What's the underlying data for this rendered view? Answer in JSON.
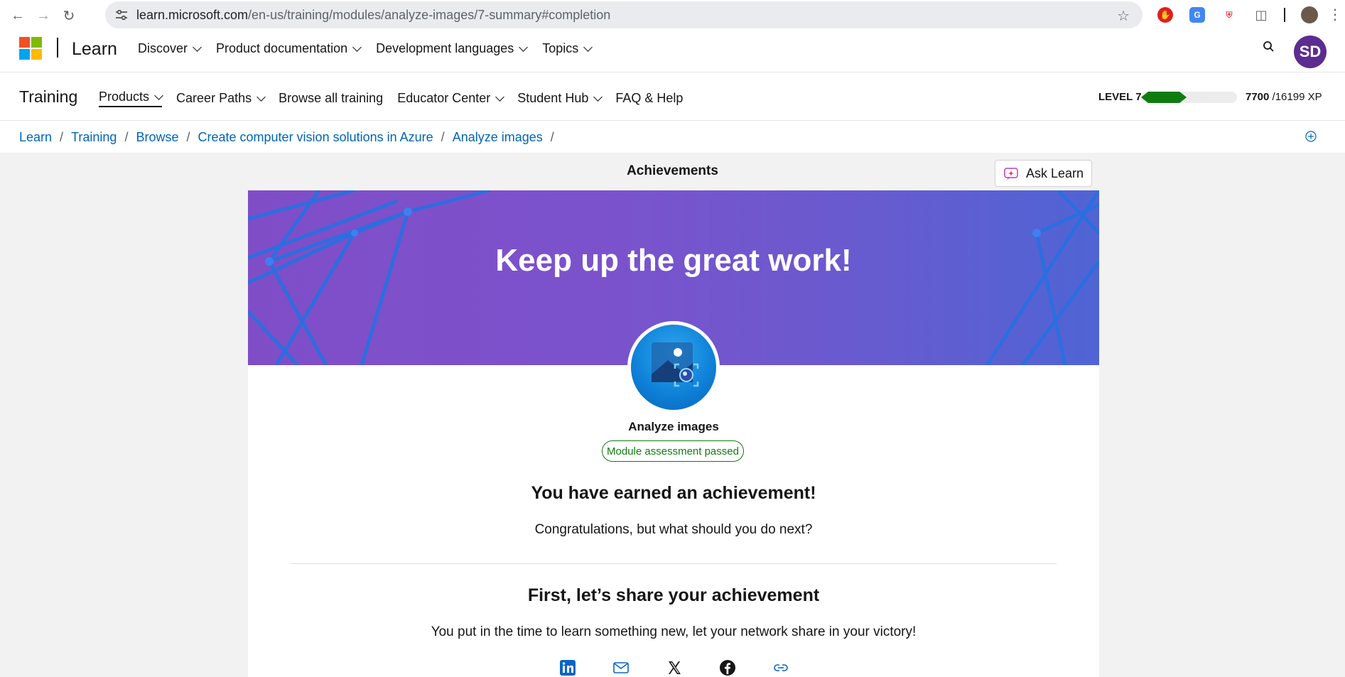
{
  "browser": {
    "url_host": "learn.microsoft.com",
    "url_path": "/en-us/training/modules/analyze-images/7-summary#completion"
  },
  "header": {
    "brand": "Learn",
    "nav": [
      {
        "label": "Discover"
      },
      {
        "label": "Product documentation"
      },
      {
        "label": "Development languages"
      },
      {
        "label": "Topics"
      }
    ],
    "avatar_initials": "SD"
  },
  "training": {
    "title": "Training",
    "nav": [
      {
        "label": "Products",
        "dropdown": true
      },
      {
        "label": "Career Paths",
        "dropdown": true
      },
      {
        "label": "Browse all training",
        "dropdown": false
      },
      {
        "label": "Educator Center",
        "dropdown": true
      },
      {
        "label": "Student Hub",
        "dropdown": true
      },
      {
        "label": "FAQ & Help",
        "dropdown": false
      }
    ],
    "level": "LEVEL 7",
    "xp_current": "7700",
    "xp_total": "/16199 XP",
    "xp_fraction": 0.475
  },
  "breadcrumb": [
    "Learn",
    "Training",
    "Browse",
    "Create computer vision solutions in Azure",
    "Analyze images"
  ],
  "main": {
    "heading": "Achievements",
    "ask_learn": "Ask Learn",
    "banner_title": "Keep up the great work!",
    "module_name": "Analyze images",
    "status_pill": "Module assessment passed",
    "earned": "You have earned an achievement!",
    "next": "Congratulations, but what should you do next?",
    "share_title": "First, let’s share your achievement",
    "share_sub": "You put in the time to learn something new, let your network share in your victory!"
  },
  "colors": {
    "accent_link": "#0065b3",
    "success": "#107c10",
    "avatar_bg": "#5c2d91"
  }
}
